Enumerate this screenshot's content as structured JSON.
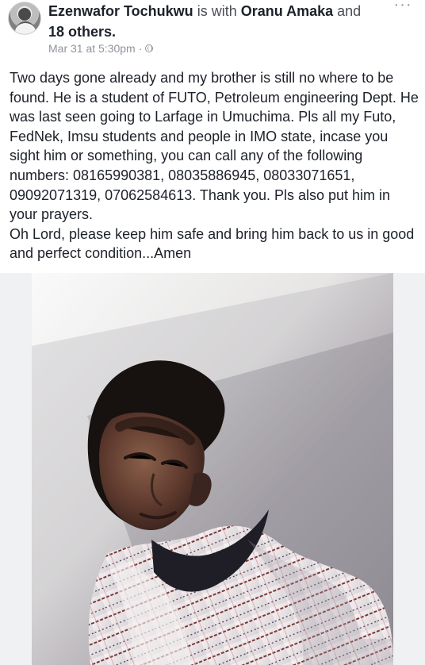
{
  "header": {
    "author": "Ezenwafor Tochukwu",
    "with_text": "is with",
    "tagged_person": "Oranu Amaka",
    "and_text": "and",
    "others": "18 others.",
    "timestamp": "Mar 31 at 5:30pm",
    "separator": "·",
    "menu_label": "···"
  },
  "post": {
    "body": "Two days gone already and my brother is still no where to be found. He is a student of FUTO, Petroleum engineering Dept. He was last seen going to Larfage in Umuchima. Pls all my Futo, FedNek, Imsu students and people in IMO state, incase you sight him or something, you can call any of the following numbers: 08165990381, 08035886945, 08033071651, 09092071319, 07062584613. Thank you. Pls also put him in your prayers.\nOh Lord, please keep him safe and bring him back to us in good and perfect condition...Amen"
  },
  "colors": {
    "text": "#1d2129",
    "secondary_text": "#4b4f56",
    "meta_text": "#90949c",
    "background": "#ffffff"
  },
  "icons": {
    "privacy": "globe-icon",
    "menu": "more-options-icon"
  }
}
